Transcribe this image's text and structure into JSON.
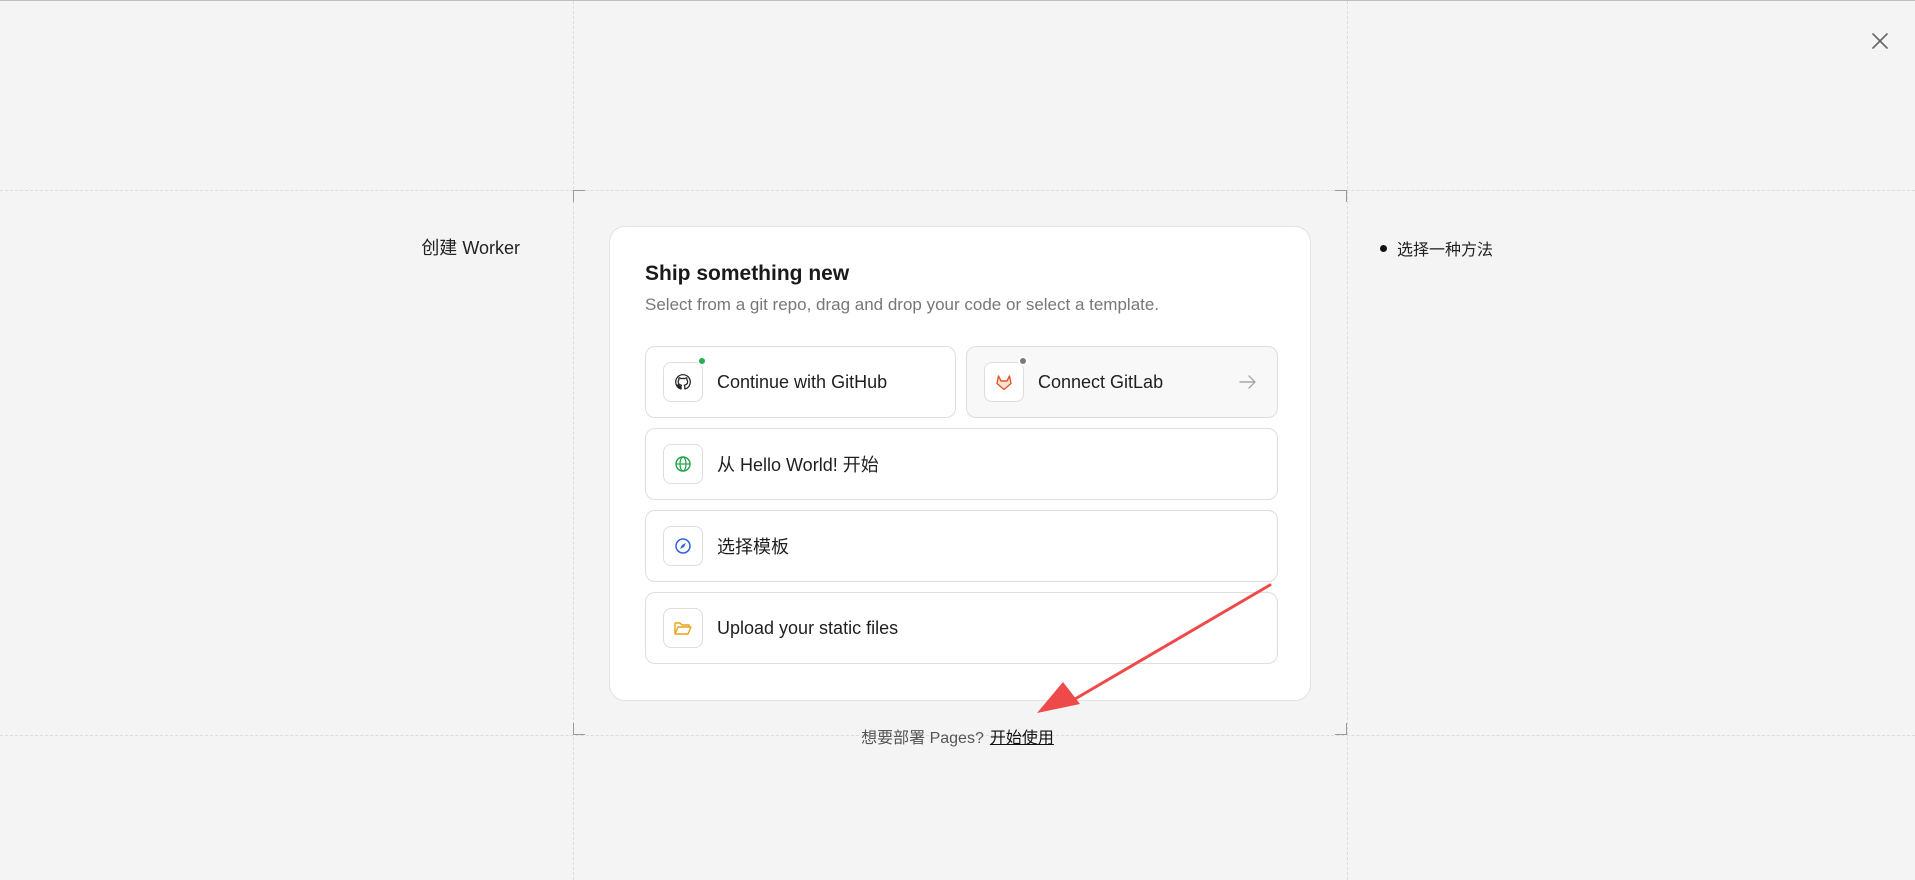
{
  "header": {
    "close_icon": "close-icon"
  },
  "sidebar": {
    "title": "创建 Worker"
  },
  "steps": {
    "current": "选择一种方法"
  },
  "card": {
    "title": "Ship something new",
    "subtitle": "Select from a git repo, drag and drop your code or select a template.",
    "options": {
      "github": {
        "label": "Continue with GitHub",
        "icon": "github-icon",
        "status_color": "#22b14c"
      },
      "gitlab": {
        "label": "Connect GitLab",
        "icon": "gitlab-icon",
        "status_color": "#7a7a7a"
      },
      "hello": {
        "label": "从 Hello World! 开始",
        "icon": "globe-icon"
      },
      "template": {
        "label": "选择模板",
        "icon": "compass-icon"
      },
      "upload": {
        "label": "Upload your static files",
        "icon": "folder-icon"
      }
    }
  },
  "footer": {
    "prompt": "想要部署 Pages?",
    "link": "开始使用"
  },
  "colors": {
    "background": "#f4f4f4",
    "annotation_arrow": "#ef4a4a",
    "gitlab_orange": "#e2582a",
    "globe_green": "#1fa34a",
    "compass_blue": "#2f5fe3",
    "folder_yellow": "#e6a21a"
  }
}
